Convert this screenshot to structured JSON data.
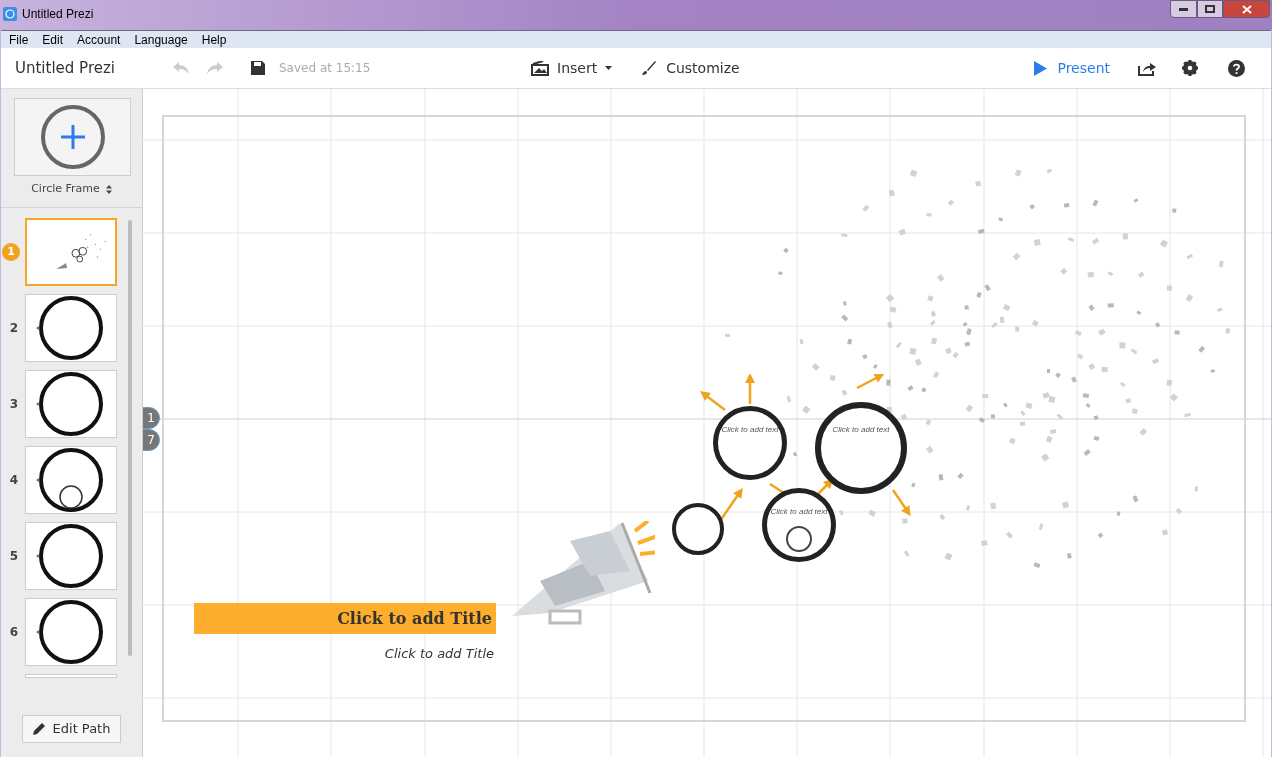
{
  "window": {
    "title": "Untitled Prezi"
  },
  "menu": [
    "File",
    "Edit",
    "Account",
    "Language",
    "Help"
  ],
  "toolbar": {
    "doc_title": "Untitled Prezi",
    "saved": "Saved at 15:15",
    "insert": "Insert",
    "customize": "Customize",
    "present": "Present"
  },
  "sidebar": {
    "frame_type": "Circle Frame",
    "edit_path": "Edit Path",
    "slides": [
      {
        "number": "1",
        "selected": true,
        "kind": "overview"
      },
      {
        "number": "2",
        "selected": false,
        "kind": "circle"
      },
      {
        "number": "3",
        "selected": false,
        "kind": "circle"
      },
      {
        "number": "4",
        "selected": false,
        "kind": "nested"
      },
      {
        "number": "5",
        "selected": false,
        "kind": "circle"
      },
      {
        "number": "6",
        "selected": false,
        "kind": "circle"
      },
      {
        "selected": false,
        "kind": "blank"
      }
    ]
  },
  "path_markers": [
    "1",
    "7"
  ],
  "canvas": {
    "title": "Click to add Title",
    "subtitle": "Click to add Title",
    "circles": [
      {
        "text": "Click to add text",
        "kind": "medium"
      },
      {
        "text": "Click to add text",
        "kind": "large"
      },
      {
        "kind": "small"
      },
      {
        "text": "Click to add text",
        "kind": "nested"
      }
    ]
  }
}
